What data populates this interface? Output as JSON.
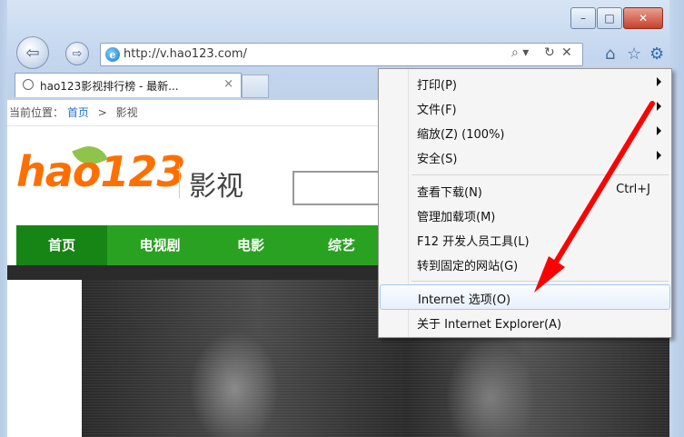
{
  "window": {
    "minimize_label": "–",
    "maximize_label": "□",
    "close_label": "✕"
  },
  "address": {
    "url": "http://v.hao123.com/",
    "search_glyph": "⌕ ▾",
    "refresh_glyph": "↻",
    "stop_glyph": "✕"
  },
  "toolbar_icons": [
    "home-icon",
    "favorites-star-icon",
    "tools-gear-icon"
  ],
  "tab": {
    "title": "hao123影视排行榜 - 最新...",
    "close": "×"
  },
  "breadcrumb": {
    "prefix": "当前位置：",
    "home": "首页",
    "separator": ">",
    "current": "影视"
  },
  "site": {
    "logo_text": "hao123",
    "logo_sub": "影视"
  },
  "nav": {
    "items": [
      "首页",
      "电视剧",
      "电影",
      "综艺"
    ]
  },
  "menu": {
    "items": [
      {
        "label": "打印(P)",
        "submenu": true
      },
      {
        "label": "文件(F)",
        "submenu": true
      },
      {
        "label": "缩放(Z) (100%)",
        "submenu": true
      },
      {
        "label": "安全(S)",
        "submenu": true
      },
      {
        "label": "查看下载(N)",
        "shortcut": "Ctrl+J"
      },
      {
        "label": "管理加载项(M)"
      },
      {
        "label": "F12 开发人员工具(L)"
      },
      {
        "label": "转到固定的网站(G)"
      },
      {
        "label": "Internet 选项(O)",
        "highlighted": true
      },
      {
        "label": "关于 Internet Explorer(A)"
      }
    ]
  },
  "colors": {
    "annotation_arrow": "#ff0000",
    "nav_green": "#2aa221",
    "logo_orange": "#ff6f00"
  }
}
